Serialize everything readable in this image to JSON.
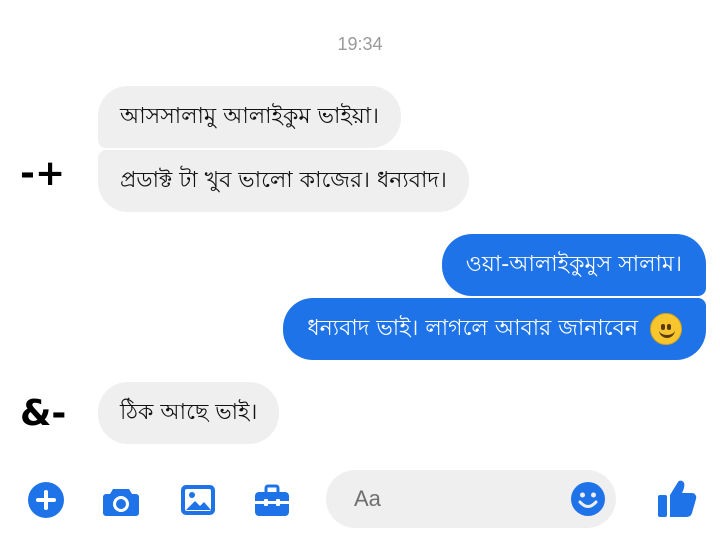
{
  "conversation": {
    "timestamp": "19:34",
    "messages": [
      {
        "direction": "incoming",
        "text": "আসসালামু আলাইকুম ভাইয়া।"
      },
      {
        "direction": "incoming",
        "text": "প্রডাক্ট টা খুব ভালো কাজের। ধন্যবাদ।"
      },
      {
        "direction": "outgoing",
        "text": "ওয়া-আলাইকুমুস সালাম।"
      },
      {
        "direction": "outgoing",
        "text": "ধন্যবাদ ভাই। লাগলে আবার জানাবেন",
        "emoji": "slightly-smiling-face"
      },
      {
        "direction": "incoming",
        "text": "ঠিক আছে ভাই।"
      }
    ]
  },
  "annotations": {
    "mark_1": "-+",
    "mark_2": "&-"
  },
  "composer": {
    "placeholder": "Aa"
  },
  "toolbar": {
    "icons": [
      "plus-icon",
      "camera-icon",
      "gallery-icon",
      "toolbox-icon",
      "emoji-icon",
      "thumbs-up-icon"
    ]
  },
  "colors": {
    "accent": "#1f73e8",
    "incoming_bubble": "#efefef",
    "outgoing_bubble": "#1f73e8",
    "timestamp": "#9a9a9a"
  }
}
